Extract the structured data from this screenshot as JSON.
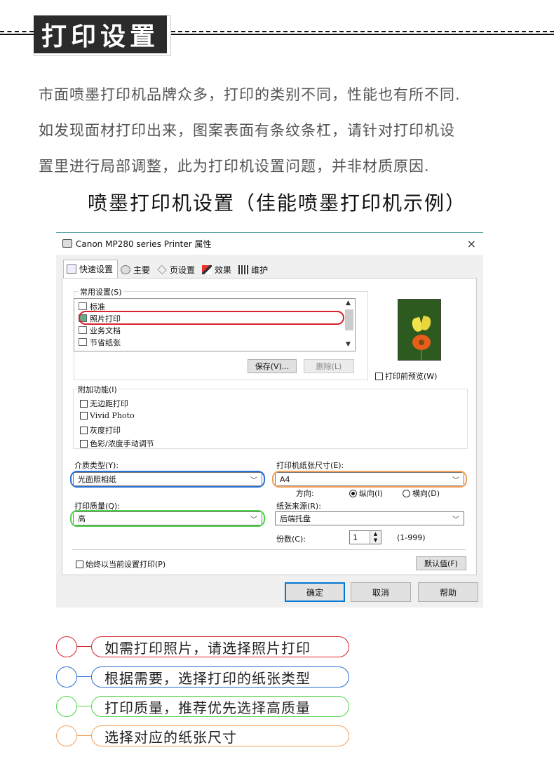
{
  "header": {
    "title": "打印设置"
  },
  "intro": {
    "lines": [
      "市面喷墨打印机品牌众多，打印的类别不同，性能也有所不同.",
      "如发现面材打印出来，图案表面有条纹条杠，请针对打印机设",
      "置里进行局部调整，此为打印机设置问题，并非材质原因."
    ]
  },
  "subtitle": "喷墨打印机设置（佳能喷墨打印机示例）",
  "dialog": {
    "title": "Canon MP280 series Printer 属性",
    "close": "×",
    "tabs": [
      "快速设置",
      "主要",
      "页设置",
      "效果",
      "维护"
    ],
    "common_settings": {
      "label": "常用设置(S)",
      "items": [
        "标准",
        "照片打印",
        "业务文档",
        "节省纸张"
      ],
      "save_button": "保存(V)...",
      "delete_button": "删除(L)"
    },
    "preview_checkbox": "打印前预览(W)",
    "additional": {
      "label": "附加功能(I)",
      "options": [
        "无边距打印",
        "Vivid Photo",
        "灰度打印",
        "色彩/浓度手动调节"
      ]
    },
    "media_type": {
      "label": "介质类型(Y):",
      "value": "光面照相纸"
    },
    "paper_size": {
      "label": "打印机纸张尺寸(E):",
      "value": "A4"
    },
    "orientation": {
      "label": "方向:",
      "portrait": "纵向(I)",
      "landscape": "横向(D)"
    },
    "print_quality": {
      "label": "打印质量(Q):",
      "value": "高"
    },
    "paper_source": {
      "label": "纸张来源(R):",
      "value": "后端托盘"
    },
    "copies": {
      "label": "份数(C):",
      "value": "1",
      "range": "(1-999)"
    },
    "always_print": "始终以当前设置打印(P)",
    "defaults_button": "默认值(F)",
    "ok_button": "确定",
    "cancel_button": "取消",
    "help_button": "帮助"
  },
  "colors": {
    "red": "#d9232d",
    "blue": "#2b6fd6",
    "green": "#4fd44a",
    "orange": "#f2a05a"
  },
  "legend": [
    {
      "text": "如需打印照片，请选择照片打印",
      "color": "#d9232d"
    },
    {
      "text": "根据需要，选择打印的纸张类型",
      "color": "#2b6fd6"
    },
    {
      "text": "打印质量，推荐优先选择高质量",
      "color": "#4fd44a"
    },
    {
      "text": "选择对应的纸张尺寸",
      "color": "#f2a05a"
    }
  ]
}
